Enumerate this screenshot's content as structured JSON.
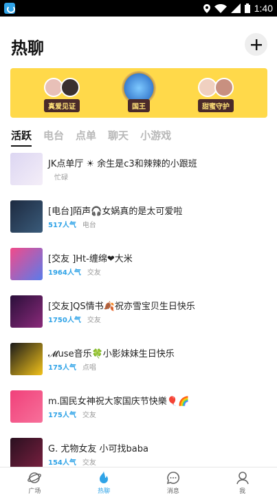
{
  "status_bar": {
    "time": "1:40"
  },
  "header": {
    "title": "热聊"
  },
  "banner": [
    {
      "label": "真爱见证"
    },
    {
      "label": "国王"
    },
    {
      "label": "甜蜜守护"
    }
  ],
  "tabs": [
    "活跃",
    "电台",
    "点单",
    "聊天",
    "小游戏"
  ],
  "rooms": [
    {
      "title": "JK点单厅 ☀ 余生是c3和辣辣的小跟班",
      "popularity": "",
      "category": "忙碌",
      "colors": [
        "#dcd6f2",
        "#f4eef8"
      ]
    },
    {
      "title": "[电台]陌声🎧女娲真的是太可爱啦",
      "popularity": "517人气",
      "category": "电台",
      "colors": [
        "#1d2a40",
        "#3a5b7a"
      ]
    },
    {
      "title": "[交友 ]Ht-缠绵❤大米",
      "popularity": "1964人气",
      "category": "交友",
      "colors": [
        "#f24a8a",
        "#5a7bea"
      ]
    },
    {
      "title": "[交友]QS情书🍂祝亦雪宝贝生日快乐",
      "popularity": "1750人气",
      "category": "交友",
      "colors": [
        "#2a0f3a",
        "#8a2a7a"
      ]
    },
    {
      "title": "𝓜use音乐🍀小影妹妹生日快乐",
      "popularity": "175人气",
      "category": "点唱",
      "colors": [
        "#1a1a1a",
        "#f2c21a"
      ]
    },
    {
      "title": " m.国民女神祝大家国庆节快樂🎈🌈",
      "popularity": "175人气",
      "category": "交友",
      "colors": [
        "#f0407a",
        "#f7709a"
      ]
    },
    {
      "title": "G. 尤物女友 小可找baba",
      "popularity": "154人气",
      "category": "交友",
      "colors": [
        "#2a1020",
        "#7a2040"
      ]
    }
  ],
  "tabbar": [
    {
      "label": "广场",
      "icon": "planet-icon"
    },
    {
      "label": "热聊",
      "icon": "flame-icon"
    },
    {
      "label": "消息",
      "icon": "chat-icon"
    },
    {
      "label": "我",
      "icon": "person-icon"
    }
  ]
}
